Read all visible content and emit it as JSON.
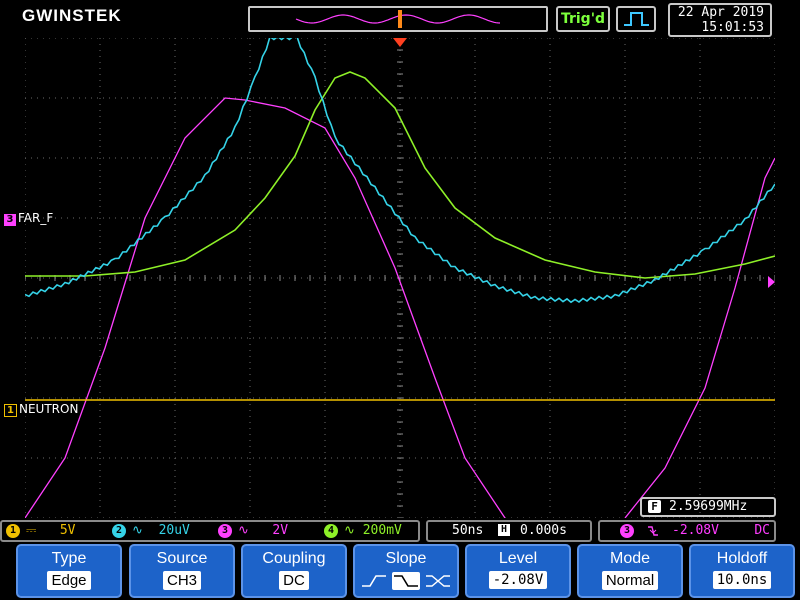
{
  "header": {
    "brand": "GWINSTEK",
    "trigger_status": "Trig'd",
    "date": "22 Apr 2019",
    "time": "15:01:53"
  },
  "channels": {
    "ch1": {
      "number": "1",
      "label": "NEUTRON",
      "scale": "5V",
      "coupling_symbol": "⎓",
      "color": "#f0c000"
    },
    "ch2": {
      "number": "2",
      "scale": "20uV",
      "coupling_symbol": "∿",
      "color": "#35d3e8"
    },
    "ch3": {
      "number": "3",
      "label": "FAR_F",
      "scale": "2V",
      "coupling_symbol": "∿",
      "color": "#ff40ff"
    },
    "ch4": {
      "number": "4",
      "scale": "200mV",
      "coupling_symbol": "∿",
      "color": "#8ef028"
    }
  },
  "measurement": {
    "icon": "F",
    "frequency": "2.59699MHz"
  },
  "timebase": {
    "scale": "50ns",
    "icon": "H",
    "position": "0.000s"
  },
  "trigger": {
    "source_num": "3",
    "level": "-2.08V",
    "coupling": "DC"
  },
  "softkeys": {
    "type": {
      "label": "Type",
      "value": "Edge"
    },
    "source": {
      "label": "Source",
      "value": "CH3"
    },
    "coupling": {
      "label": "Coupling",
      "value": "DC"
    },
    "slope": {
      "label": "Slope",
      "selected": "falling"
    },
    "level": {
      "label": "Level",
      "value": "-2.08V"
    },
    "mode": {
      "label": "Mode",
      "value": "Normal"
    },
    "holdoff": {
      "label": "Holdoff",
      "value": "10.0ns"
    }
  },
  "colors": {
    "softkey_bg": "#1d63c9",
    "trigger_marker": "#ff4020"
  }
}
